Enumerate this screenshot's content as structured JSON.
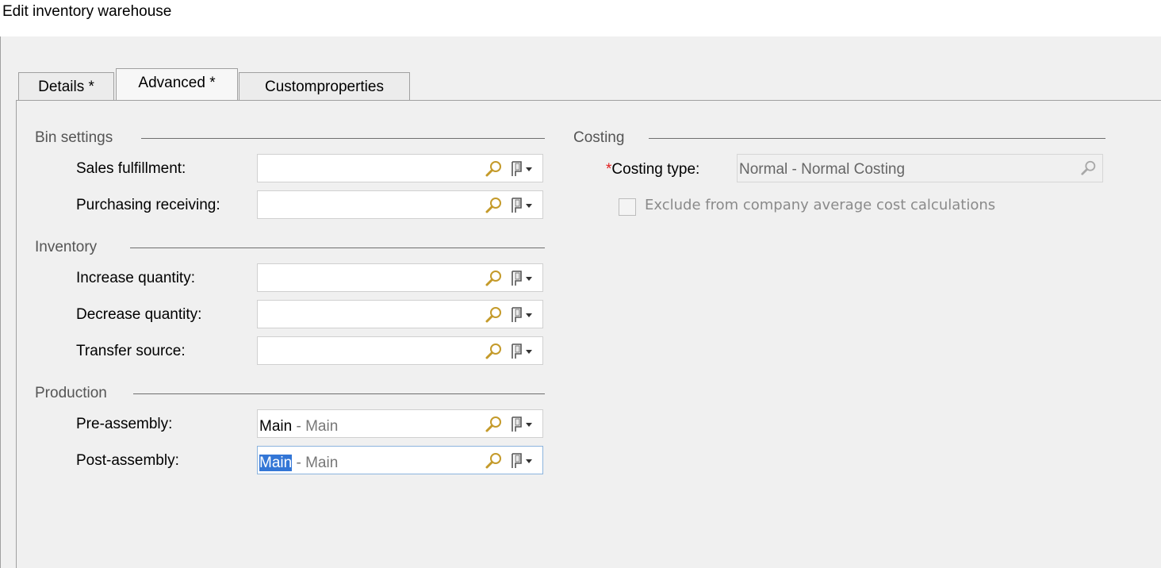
{
  "window": {
    "title": "Edit inventory warehouse"
  },
  "tabs": [
    {
      "label": "Details *"
    },
    {
      "label": "Advanced *"
    },
    {
      "label": "Customproperties"
    }
  ],
  "bin_settings": {
    "label": "Bin settings",
    "sales_fulfillment": {
      "label": "Sales fulfillment:",
      "code": "",
      "desc": ""
    },
    "purchasing_receiving": {
      "label": "Purchasing receiving:",
      "code": "",
      "desc": ""
    }
  },
  "inventory": {
    "label": "Inventory",
    "increase_quantity": {
      "label": "Increase quantity:",
      "code": "",
      "desc": ""
    },
    "decrease_quantity": {
      "label": "Decrease quantity:",
      "code": "",
      "desc": ""
    },
    "transfer_source": {
      "label": "Transfer source:",
      "code": "",
      "desc": ""
    }
  },
  "production": {
    "label": "Production",
    "pre_assembly": {
      "label": "Pre-assembly:",
      "code": "Main",
      "desc": " - Main"
    },
    "post_assembly": {
      "label": "Post-assembly:",
      "code": "Main",
      "desc": " - Main"
    }
  },
  "costing": {
    "label": "Costing",
    "costing_type_star": "*",
    "costing_type_label": "Costing type:",
    "costing_type_value": "Normal - Normal Costing",
    "exclude_label": "Exclude from company average cost calculations",
    "exclude_checked": false
  },
  "icons": {
    "lookup": "search-icon",
    "menu": "flag-dropdown-icon"
  },
  "colors": {
    "required": "#e21d1d",
    "selection": "#3376d6"
  }
}
